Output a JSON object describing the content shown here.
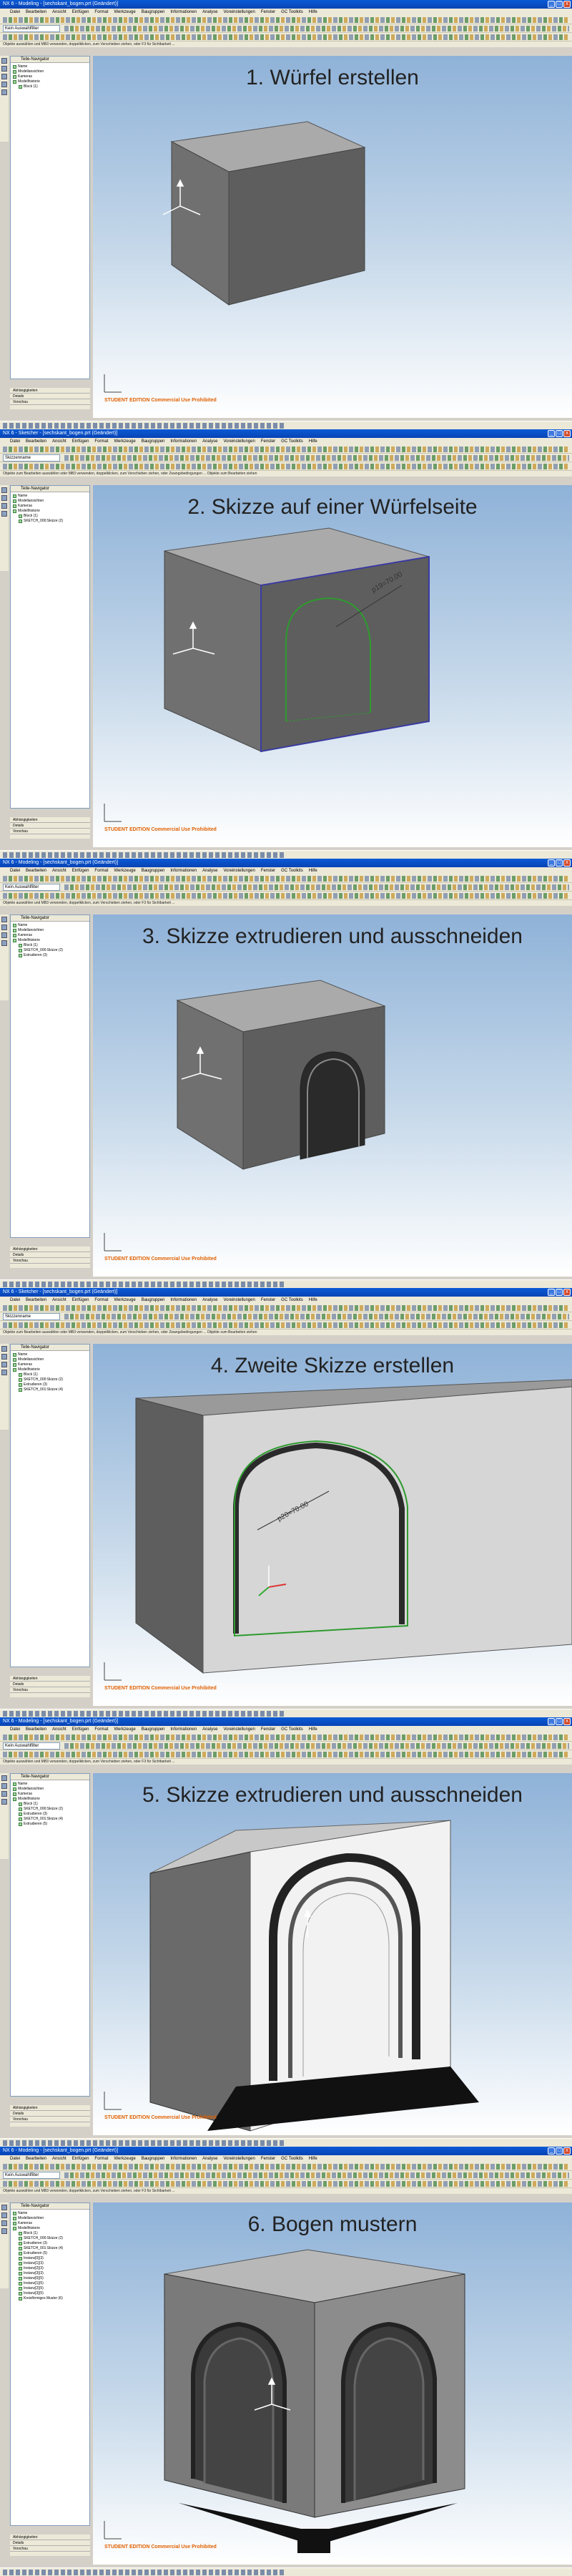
{
  "window": {
    "titles": [
      "NX 6 - Modeling - [sechskant_bogen.prt (Geändert)]",
      "NX 6 - Sketcher - [sechskant_bogen.prt (Geändert)]",
      "NX 6 - Modeling - [sechskant_bogen.prt (Geändert)]",
      "NX 6 - Sketcher - [sechskant_bogen.prt (Geändert)]",
      "NX 6 - Modeling - [sechskant_bogen.prt (Geändert)]",
      "NX 6 - Modeling - [sechskant_bogen.prt (Geändert)]"
    ],
    "minimize": "_",
    "maximize": "□",
    "close": "x"
  },
  "menu": [
    "Datei",
    "Bearbeiten",
    "Ansicht",
    "Einfügen",
    "Format",
    "Werkzeuge",
    "Baugruppen",
    "Informationen",
    "Analyse",
    "Voreinstellungen",
    "Fenster",
    "GC Toolkits",
    "Hilfe"
  ],
  "toolbar": {
    "filter_combo": "Kein Auswahlfilter",
    "combo_sketch": "Skizzenname"
  },
  "status": {
    "modeling": "Objekte auswählen und MB3 verwenden, doppelklicken, zum Verschieben ziehen, oder F3 für Sichtbarkeit ...",
    "sketcher": "Objekte zum Bearbeiten auswählen oder MB3 verwenden, doppelklicken, zum Verschieben ziehen, oder Zwangsbedingungen ... Objekte zum Bearbeiten ziehen"
  },
  "navigator": {
    "header": "Teile-Navigator",
    "bottom_labels": [
      "Abhängigkeiten",
      "Details",
      "Vorschau"
    ],
    "panels": [
      [
        "Name",
        "Modellansichten",
        "Kameras",
        "Modellhistorie",
        "Block (1)"
      ],
      [
        "Name",
        "Modellansichten",
        "Kameras",
        "Modellhistorie",
        "Block (1)",
        "SKETCH_000:Skizze (2)"
      ],
      [
        "Name",
        "Modellansichten",
        "Kameras",
        "Modellhistorie",
        "Block (1)",
        "SKETCH_000:Skizze (2)",
        "Extrudieren (3)"
      ],
      [
        "Name",
        "Modellansichten",
        "Kameras",
        "Modellhistorie",
        "Block (1)",
        "SKETCH_000:Skizze (2)",
        "Extrudieren (3)",
        "SKETCH_001:Skizze (4)"
      ],
      [
        "Name",
        "Modellansichten",
        "Kameras",
        "Modellhistorie",
        "Block (1)",
        "SKETCH_000:Skizze (2)",
        "Extrudieren (3)",
        "SKETCH_001:Skizze (4)",
        "Extrudieren (5)"
      ],
      [
        "Name",
        "Modellansichten",
        "Kameras",
        "Modellhistorie",
        "Block (1)",
        "SKETCH_000:Skizze (2)",
        "Extrudieren (3)",
        "SKETCH_001:Skizze (4)",
        "Extrudieren (5)",
        "Instanz[0](3)",
        "Instanz[1](3)",
        "Instanz[2](3)",
        "Instanz[3](3)",
        "Instanz[0](5)",
        "Instanz[1](5)",
        "Instanz[2](5)",
        "Instanz[3](5)",
        "Kreisförmiges Muster (6)"
      ]
    ]
  },
  "steps": [
    "1. Würfel erstellen",
    "2. Skizze auf einer Würfelseite",
    "3. Skizze extrudieren und ausschneiden",
    "4. Zweite Skizze erstellen",
    "5. Skizze extrudieren und ausschneiden",
    "6. Bogen mustern"
  ],
  "viewport": {
    "watermark": "STUDENT EDITION Commercial Use Prohibited",
    "dimension_labels": [
      "p19=70.00",
      "p20=70.00"
    ]
  },
  "colors": {
    "titlebar": "#0843b4",
    "chrome": "#ece9d8",
    "cube_top": "#aaaaaa",
    "cube_left": "#707070",
    "cube_right": "#5c5c5c",
    "sketch_line": "#2e9a2e",
    "watermark": "#e06000"
  }
}
